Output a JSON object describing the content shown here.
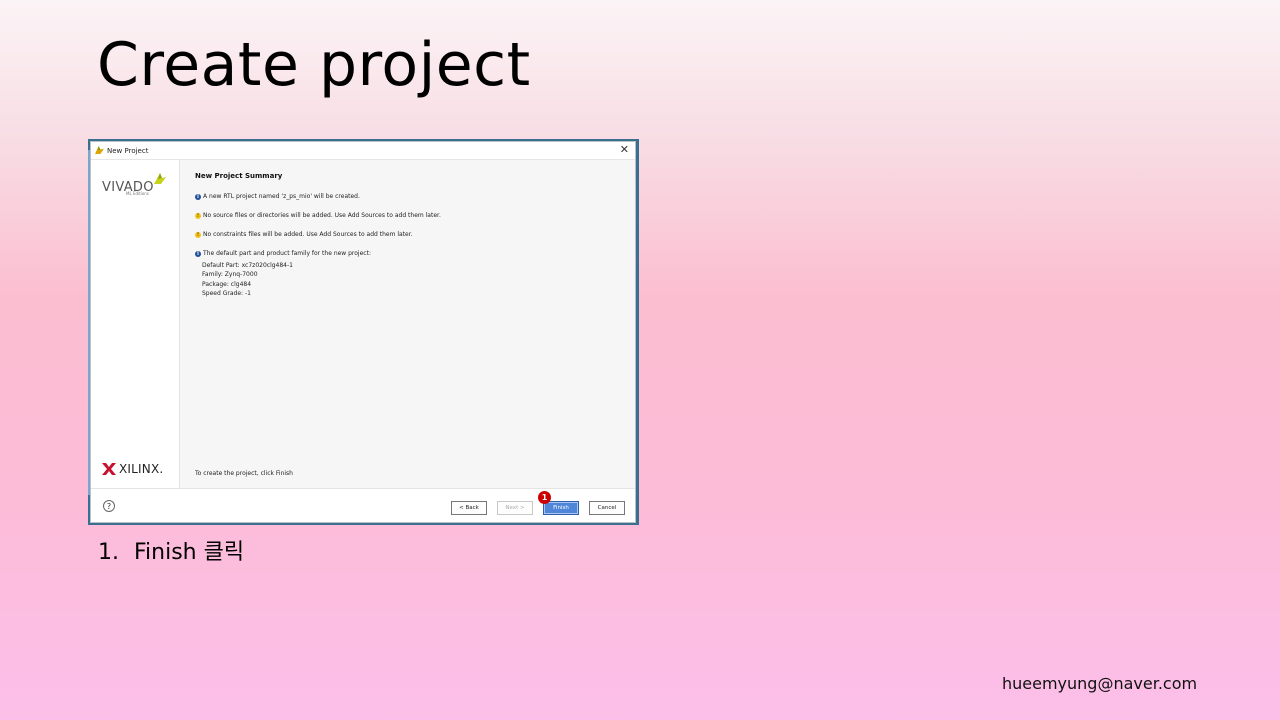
{
  "slide": {
    "title": "Create project",
    "instruction_number": "1.",
    "instruction_text": "Finish 클릭",
    "email": "hueemyung@naver.com"
  },
  "dialog": {
    "window_title": "New Project",
    "close_glyph": "✕",
    "brand": {
      "vivado": "VIVADO",
      "edition": "ML Editions",
      "xilinx": "XILINX."
    },
    "summary": {
      "heading": "New Project Summary",
      "messages": [
        {
          "icon": "info-icon",
          "text": "A new RTL project named 'z_ps_mio' will be created."
        },
        {
          "icon": "warning-icon",
          "text": "No source files or directories will be added. Use Add Sources to add them later."
        },
        {
          "icon": "warning-icon",
          "text": "No constraints files will be added. Use Add Sources to add them later."
        },
        {
          "icon": "info-icon",
          "text": "The default part and product family for the new project:"
        }
      ],
      "details": [
        "Default Part: xc7z020clg484-1",
        "Family: Zynq-7000",
        "Package: clg484",
        "Speed Grade: -1"
      ],
      "create_hint": "To create the project, click Finish"
    },
    "buttons": {
      "help": "?",
      "back": "< Back",
      "next": "Next >",
      "finish": "Finish",
      "cancel": "Cancel"
    },
    "step_badge": "1",
    "colors": {
      "finish_button": "#4f86d9",
      "info_icon": "#1f4e9a",
      "warning_icon": "#f2c21b",
      "badge": "#cc0000"
    }
  }
}
